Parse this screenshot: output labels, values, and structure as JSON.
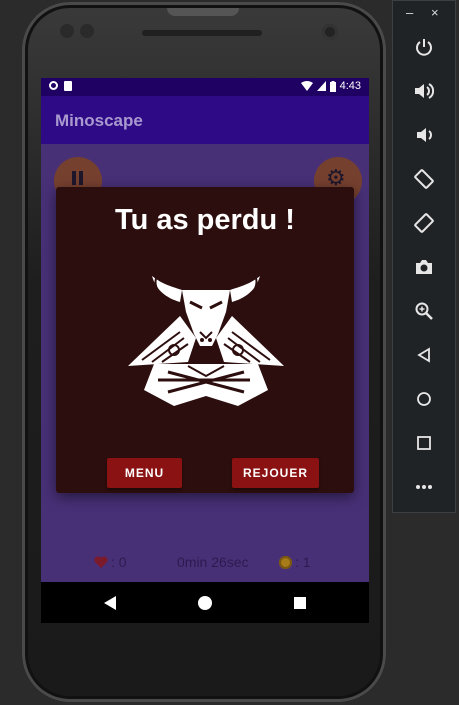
{
  "app": {
    "title": "Minoscape"
  },
  "status_bar": {
    "time": "4:43"
  },
  "dialog": {
    "message": "Tu as perdu !",
    "menu_label": "MENU",
    "replay_label": "REJOUER"
  },
  "stats": {
    "lives": ": 0",
    "time": "0min  26sec",
    "coins": ": 1"
  },
  "emulator": {
    "minimize": "–",
    "close": "×",
    "buttons": [
      {
        "icon": "power-icon"
      },
      {
        "icon": "volume-up-icon"
      },
      {
        "icon": "volume-down-icon"
      },
      {
        "icon": "rotate-left-icon"
      },
      {
        "icon": "rotate-right-icon"
      },
      {
        "icon": "camera-icon"
      },
      {
        "icon": "zoom-icon"
      },
      {
        "icon": "back-icon"
      },
      {
        "icon": "home-icon"
      },
      {
        "icon": "overview-icon"
      },
      {
        "icon": "more-icon"
      }
    ]
  },
  "colors": {
    "app_bar": "#2e0a86",
    "status_bar": "#1f0063",
    "background": "#5a3f8c",
    "dialog_bg": "#2d0e0e",
    "button_bg": "#8a1212",
    "round_button": "#a0581e"
  }
}
